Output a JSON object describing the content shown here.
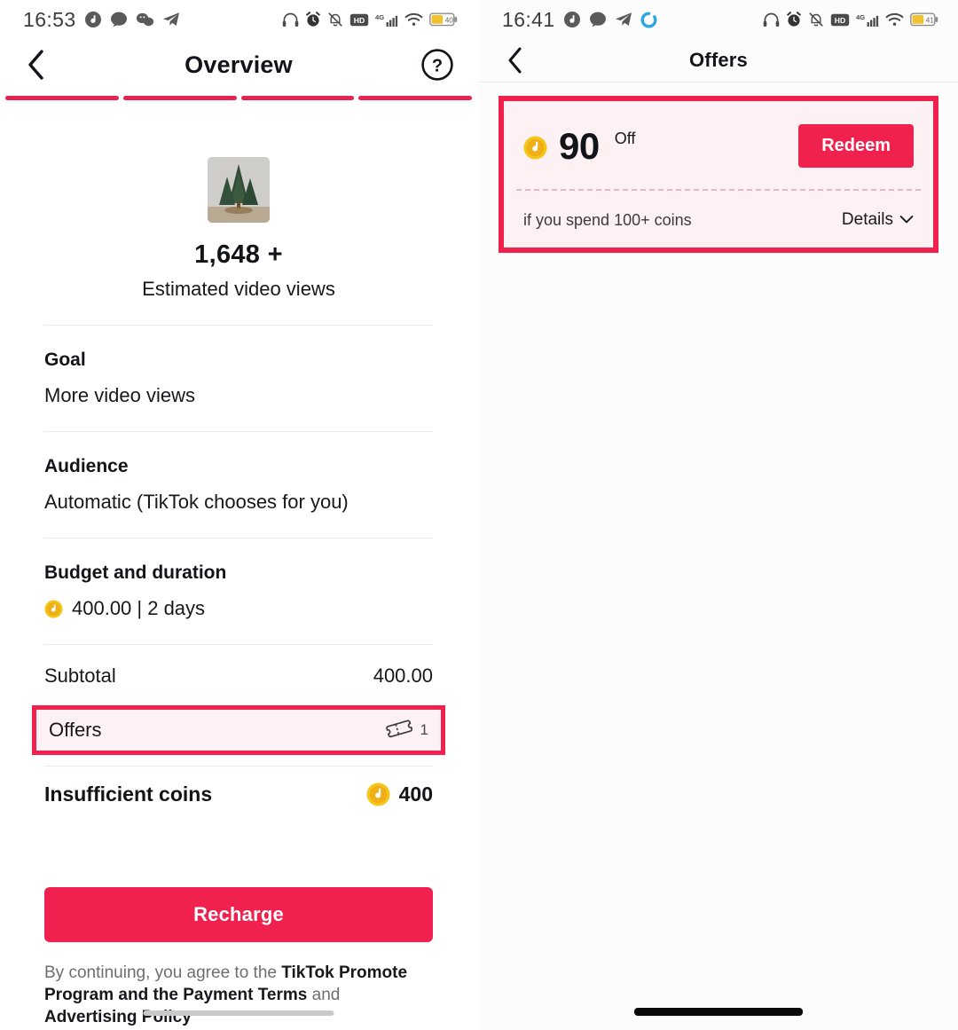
{
  "accent": "#F0224D",
  "accent_alt": "#E8224E",
  "coin_color": "#F5C518",
  "left_screen": {
    "status": {
      "time": "16:53",
      "battery_text": "40",
      "signal_label": "4G",
      "hd_label": "HD",
      "icons": [
        "globe-music-icon",
        "chat-bubble-icon",
        "wechat-icon",
        "telegram-icon",
        "headphones-icon",
        "alarm-clock-icon",
        "bell-muted-icon",
        "hd-icon",
        "signal-4g-icon",
        "wifi-icon",
        "battery-icon"
      ]
    },
    "nav": {
      "title": "Overview",
      "back_icon": "chevron-left-icon",
      "help_icon": "question-mark-circle-icon"
    },
    "steps": {
      "total": 4,
      "completed": 4
    },
    "summary": {
      "thumbnail_alt": "pine-tree-craft-thumbnail",
      "value": "1,648 +",
      "label": "Estimated video views"
    },
    "fields": [
      {
        "label": "Goal",
        "value": "More video views",
        "has_coin": false
      },
      {
        "label": "Audience",
        "value": "Automatic (TikTok chooses for you)",
        "has_coin": false
      },
      {
        "label": "Budget and duration",
        "value": "400.00 | 2 days",
        "has_coin": true
      }
    ],
    "totals": {
      "subtotal_label": "Subtotal",
      "subtotal_value": "400.00",
      "offers_label": "Offers",
      "offers_count": "1",
      "offers_icon": "ticket-icon",
      "insufficient_label": "Insufficient coins",
      "insufficient_value": "400"
    },
    "cta": {
      "label": "Recharge"
    },
    "legal": {
      "part1": "By continuing, you agree to the ",
      "bold1": "TikTok Promote Program and the Payment Terms",
      "part2": " and ",
      "bold2": "Advertising Policy"
    }
  },
  "right_screen": {
    "status": {
      "time": "16:41",
      "battery_text": "41",
      "signal_label": "4G",
      "hd_label": "HD",
      "icons": [
        "globe-music-icon",
        "chat-bubble-icon",
        "telegram-icon",
        "loading-spinner-icon",
        "headphones-icon",
        "alarm-clock-icon",
        "bell-muted-icon",
        "hd-icon",
        "signal-4g-icon",
        "wifi-icon",
        "battery-icon"
      ]
    },
    "nav": {
      "title": "Offers",
      "back_icon": "chevron-left-icon"
    },
    "offer": {
      "amount": "90",
      "off_label": "Off",
      "redeem_label": "Redeem",
      "condition": "if you spend 100+ coins",
      "details_label": "Details",
      "details_icon": "chevron-down-icon"
    }
  }
}
